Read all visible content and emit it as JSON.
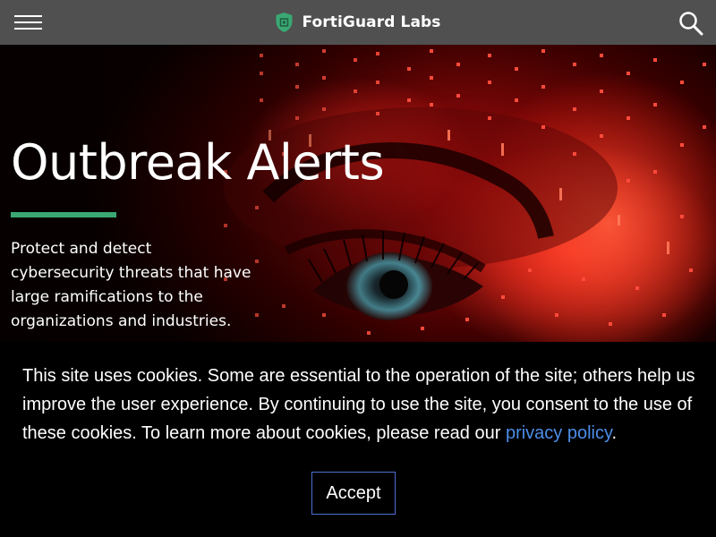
{
  "header": {
    "brand_name": "FortiGuard Labs",
    "menu_icon": "hamburger-menu-icon",
    "search_icon": "search-icon",
    "brand_icon": "shield-logo-icon",
    "brand_color": "#3aa873",
    "background": "#505050"
  },
  "hero": {
    "title": "Outbreak Alerts",
    "description": "Protect and detect cybersecurity threats that have large ramifications to the organizations and industries.",
    "accent_color": "#3aa873"
  },
  "cookie_banner": {
    "text_before_link": "This site uses cookies. Some are essential to the operation of the site; others help us improve the user experience. By continuing to use the site, you consent to the use of these cookies. To learn more about cookies, please read our ",
    "link_label": "privacy policy",
    "text_after_link": ".",
    "accept_label": "Accept",
    "link_color": "#4d8ee8"
  }
}
